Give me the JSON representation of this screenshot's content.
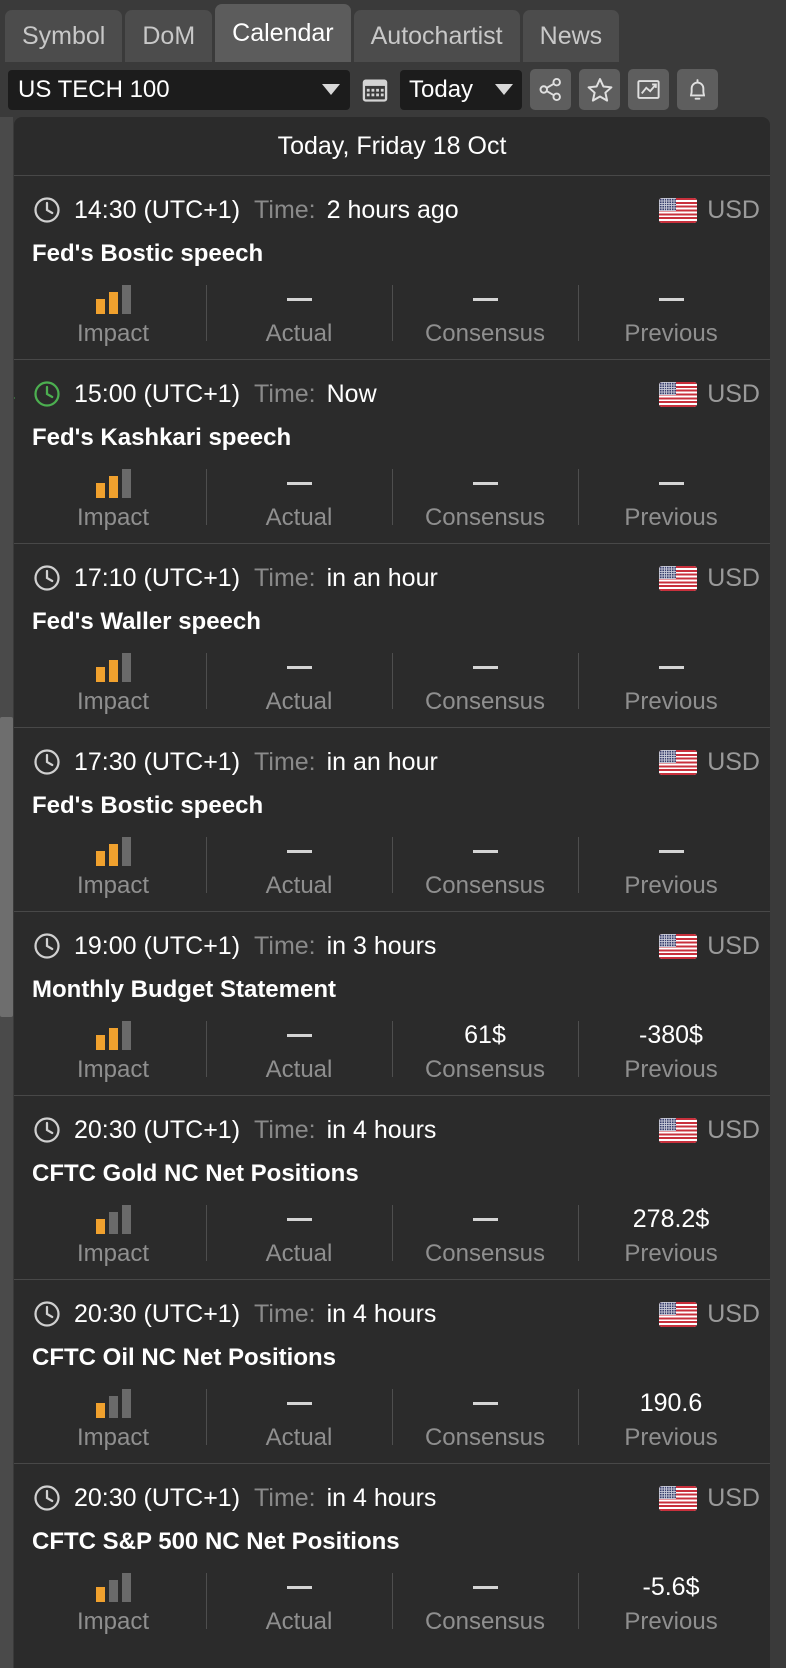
{
  "tabs": [
    {
      "label": "Symbol",
      "active": false
    },
    {
      "label": "DoM",
      "active": false
    },
    {
      "label": "Calendar",
      "active": true
    },
    {
      "label": "Autochartist",
      "active": false
    },
    {
      "label": "News",
      "active": false
    }
  ],
  "toolbar": {
    "symbol_value": "US TECH 100",
    "period_value": "Today",
    "icons": [
      "calendar-icon",
      "share-icon",
      "star-icon",
      "chart-icon",
      "bell-icon"
    ]
  },
  "colors": {
    "accent_now": "#4caf50",
    "impact_on": "#f0a12e",
    "impact_off": "#6a6a6a",
    "panel_bg": "#2b2b2b",
    "app_bg": "#3a3a3a"
  },
  "column_captions": {
    "impact": "Impact",
    "actual": "Actual",
    "consensus": "Consensus",
    "previous": "Previous"
  },
  "day_header": "Today, Friday 18 Oct",
  "time_label": "Time:",
  "currency": "USD",
  "flag": "us-flag-icon",
  "dash": "—",
  "events": [
    {
      "time": "14:30 (UTC+1)",
      "relative": "2 hours ago",
      "title": "Fed's Bostic speech",
      "impact": 2,
      "actual": "—",
      "consensus": "—",
      "previous": "—",
      "is_now": false
    },
    {
      "time": "15:00 (UTC+1)",
      "relative": "Now",
      "title": "Fed's Kashkari speech",
      "impact": 2,
      "actual": "—",
      "consensus": "—",
      "previous": "—",
      "is_now": true
    },
    {
      "time": "17:10 (UTC+1)",
      "relative": "in an hour",
      "title": "Fed's Waller speech",
      "impact": 2,
      "actual": "—",
      "consensus": "—",
      "previous": "—",
      "is_now": false
    },
    {
      "time": "17:30 (UTC+1)",
      "relative": "in an hour",
      "title": "Fed's Bostic speech",
      "impact": 2,
      "actual": "—",
      "consensus": "—",
      "previous": "—",
      "is_now": false
    },
    {
      "time": "19:00 (UTC+1)",
      "relative": "in 3 hours",
      "title": "Monthly Budget Statement",
      "impact": 2,
      "actual": "—",
      "consensus": "61$",
      "previous": "-380$",
      "is_now": false
    },
    {
      "time": "20:30 (UTC+1)",
      "relative": "in 4 hours",
      "title": "CFTC Gold NC Net Positions",
      "impact": 1,
      "actual": "—",
      "consensus": "—",
      "previous": "278.2$",
      "is_now": false
    },
    {
      "time": "20:30 (UTC+1)",
      "relative": "in 4 hours",
      "title": "CFTC Oil NC Net Positions",
      "impact": 1,
      "actual": "—",
      "consensus": "—",
      "previous": "190.6",
      "is_now": false
    },
    {
      "time": "20:30 (UTC+1)",
      "relative": "in 4 hours",
      "title": "CFTC S&P 500 NC Net Positions",
      "impact": 1,
      "actual": "—",
      "consensus": "—",
      "previous": "-5.6$",
      "is_now": false
    }
  ]
}
